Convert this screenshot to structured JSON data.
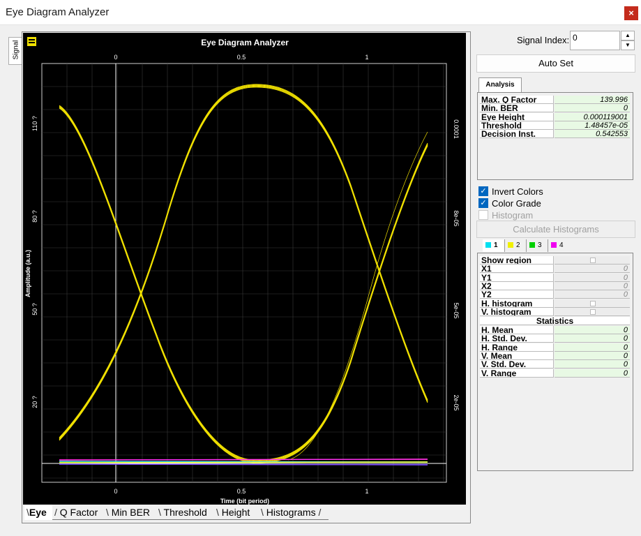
{
  "window": {
    "title": "Eye Diagram Analyzer",
    "close_glyph": "×"
  },
  "side_tab": {
    "label": "Signal"
  },
  "plot": {
    "title": "Eye Diagram Analyzer",
    "xlabel": "Time (bit period)",
    "ylabel": "Amplitude (a.u.)",
    "x_ticks": [
      "0",
      "0.5",
      "1"
    ],
    "y_ticks_left": [
      "110 ?",
      "80 ?",
      "50 ?",
      "20 ?"
    ],
    "y_ticks_right": [
      "0.0001",
      "8e-05",
      "5e-05",
      "2e-05"
    ],
    "background": "#000000",
    "trace_color": "#f0e000"
  },
  "plot_tabs": [
    "Eye",
    "Q Factor",
    "Min BER",
    "Threshold",
    "Height",
    "Histograms"
  ],
  "signal_index": {
    "label": "Signal Index:",
    "value": "0"
  },
  "auto_set": "Auto Set",
  "analysis": {
    "tab": "Analysis",
    "rows": [
      {
        "name": "Max. Q Factor",
        "value": "139.996"
      },
      {
        "name": "Min. BER",
        "value": "0"
      },
      {
        "name": "Eye Height",
        "value": "0.000119001"
      },
      {
        "name": "Threshold",
        "value": "1.48457e-05"
      },
      {
        "name": "Decision Inst.",
        "value": "0.542553"
      }
    ]
  },
  "options": {
    "invert_colors": {
      "label": "Invert Colors",
      "checked": true
    },
    "color_grade": {
      "label": "Color Grade",
      "checked": true
    },
    "histogram": {
      "label": "Histogram",
      "checked": false
    }
  },
  "calc_histograms": "Calculate Histograms",
  "region_tabs": [
    {
      "label": "1",
      "color": "#00e0f0"
    },
    {
      "label": "2",
      "color": "#f0f000"
    },
    {
      "label": "3",
      "color": "#00d000"
    },
    {
      "label": "4",
      "color": "#f000f0"
    }
  ],
  "region": {
    "rows": [
      {
        "name": "Show region",
        "value": ""
      },
      {
        "name": "X1",
        "value": "0"
      },
      {
        "name": "Y1",
        "value": "0"
      },
      {
        "name": "X2",
        "value": "0"
      },
      {
        "name": "Y2",
        "value": "0"
      },
      {
        "name": "H. histogram",
        "value": ""
      },
      {
        "name": "V. histogram",
        "value": ""
      }
    ],
    "statistics_header": "Statistics",
    "stats": [
      {
        "name": "H. Mean",
        "value": "0"
      },
      {
        "name": "H. Std. Dev.",
        "value": "0"
      },
      {
        "name": "H. Range",
        "value": "0"
      },
      {
        "name": "V. Mean",
        "value": "0"
      },
      {
        "name": "V. Std. Dev.",
        "value": "0"
      },
      {
        "name": "V. Range",
        "value": "0"
      }
    ]
  }
}
